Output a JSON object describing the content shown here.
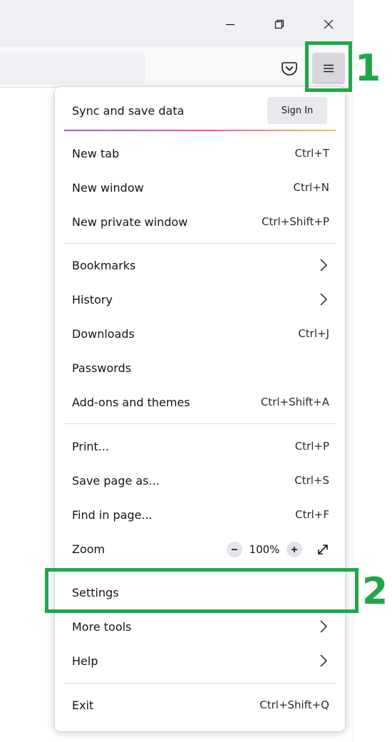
{
  "window": {
    "controls": [
      "minimize-icon",
      "restore-icon",
      "close-icon"
    ]
  },
  "toolbar": {
    "icons": [
      "pocket-icon",
      "hamburger-menu-icon"
    ]
  },
  "annotations": {
    "color": "#22a64a",
    "marker_1": "1",
    "marker_2": "2"
  },
  "menu": {
    "sync": {
      "label": "Sync and save data",
      "signin_label": "Sign In",
      "gradient": [
        "#9059ff",
        "#ff4aa2",
        "#ffbd4f"
      ]
    },
    "group1": [
      {
        "label": "New tab",
        "shortcut": "Ctrl+T"
      },
      {
        "label": "New window",
        "shortcut": "Ctrl+N"
      },
      {
        "label": "New private window",
        "shortcut": "Ctrl+Shift+P"
      }
    ],
    "group2": [
      {
        "label": "Bookmarks",
        "submenu": true
      },
      {
        "label": "History",
        "submenu": true
      },
      {
        "label": "Downloads",
        "shortcut": "Ctrl+J"
      },
      {
        "label": "Passwords"
      },
      {
        "label": "Add-ons and themes",
        "shortcut": "Ctrl+Shift+A"
      }
    ],
    "group3": [
      {
        "label": "Print...",
        "shortcut": "Ctrl+P"
      },
      {
        "label": "Save page as...",
        "shortcut": "Ctrl+S"
      },
      {
        "label": "Find in page...",
        "shortcut": "Ctrl+F"
      }
    ],
    "zoom": {
      "label": "Zoom",
      "value": "100%",
      "icons": [
        "zoom-out-icon",
        "zoom-in-icon",
        "fullscreen-icon"
      ]
    },
    "group4": [
      {
        "label": "Settings"
      },
      {
        "label": "More tools",
        "submenu": true
      },
      {
        "label": "Help",
        "submenu": true
      }
    ],
    "exit": {
      "label": "Exit",
      "shortcut": "Ctrl+Shift+Q"
    }
  }
}
